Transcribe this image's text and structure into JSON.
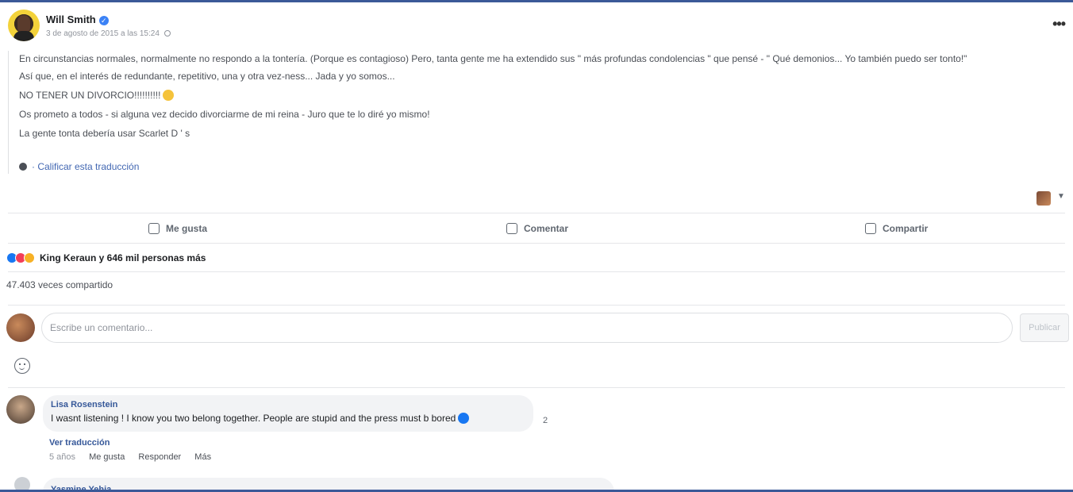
{
  "post": {
    "author": "Will Smith",
    "date": "3 de agosto de 2015 a las 15:24",
    "paragraphs": [
      "En circunstancias normales, normalmente no respondo a la tontería. (Porque es contagioso) Pero, tanta gente me ha extendido sus \" más profundas condolencias \" que pensé - \" Qué demonios... Yo también puedo ser tonto!\"",
      "Así que, en el interés de redundante, repetitivo, una y otra vez-ness... Jada y yo somos...",
      "NO TENER UN DIVORCIO!!!!!!!!!!",
      "Os prometo a todos - si alguna vez decido divorciarme de mi reina - Juro que te lo diré yo mismo!",
      "La gente tonta debería usar Scarlet D ' s"
    ],
    "rate_translation": "· Calificar esta traducción"
  },
  "actions": {
    "like": "Me gusta",
    "comment": "Comentar",
    "share": "Compartir"
  },
  "reactions": {
    "summary": "King Keraun y 646 mil personas más",
    "shares": "47.403 veces compartido"
  },
  "composer": {
    "placeholder": "Escribe un comentario...",
    "publish": "Publicar"
  },
  "comments": [
    {
      "author": "Lisa Rosenstein",
      "text": "I wasnt listening ! I know you two belong together. People are stupid and the press must b bored",
      "reply_count": "2",
      "see_translation": "Ver traducción",
      "time": "5 años",
      "like": "Me gusta",
      "reply": "Responder",
      "more": "Más"
    },
    {
      "author": "Yasmine Yehia"
    }
  ]
}
